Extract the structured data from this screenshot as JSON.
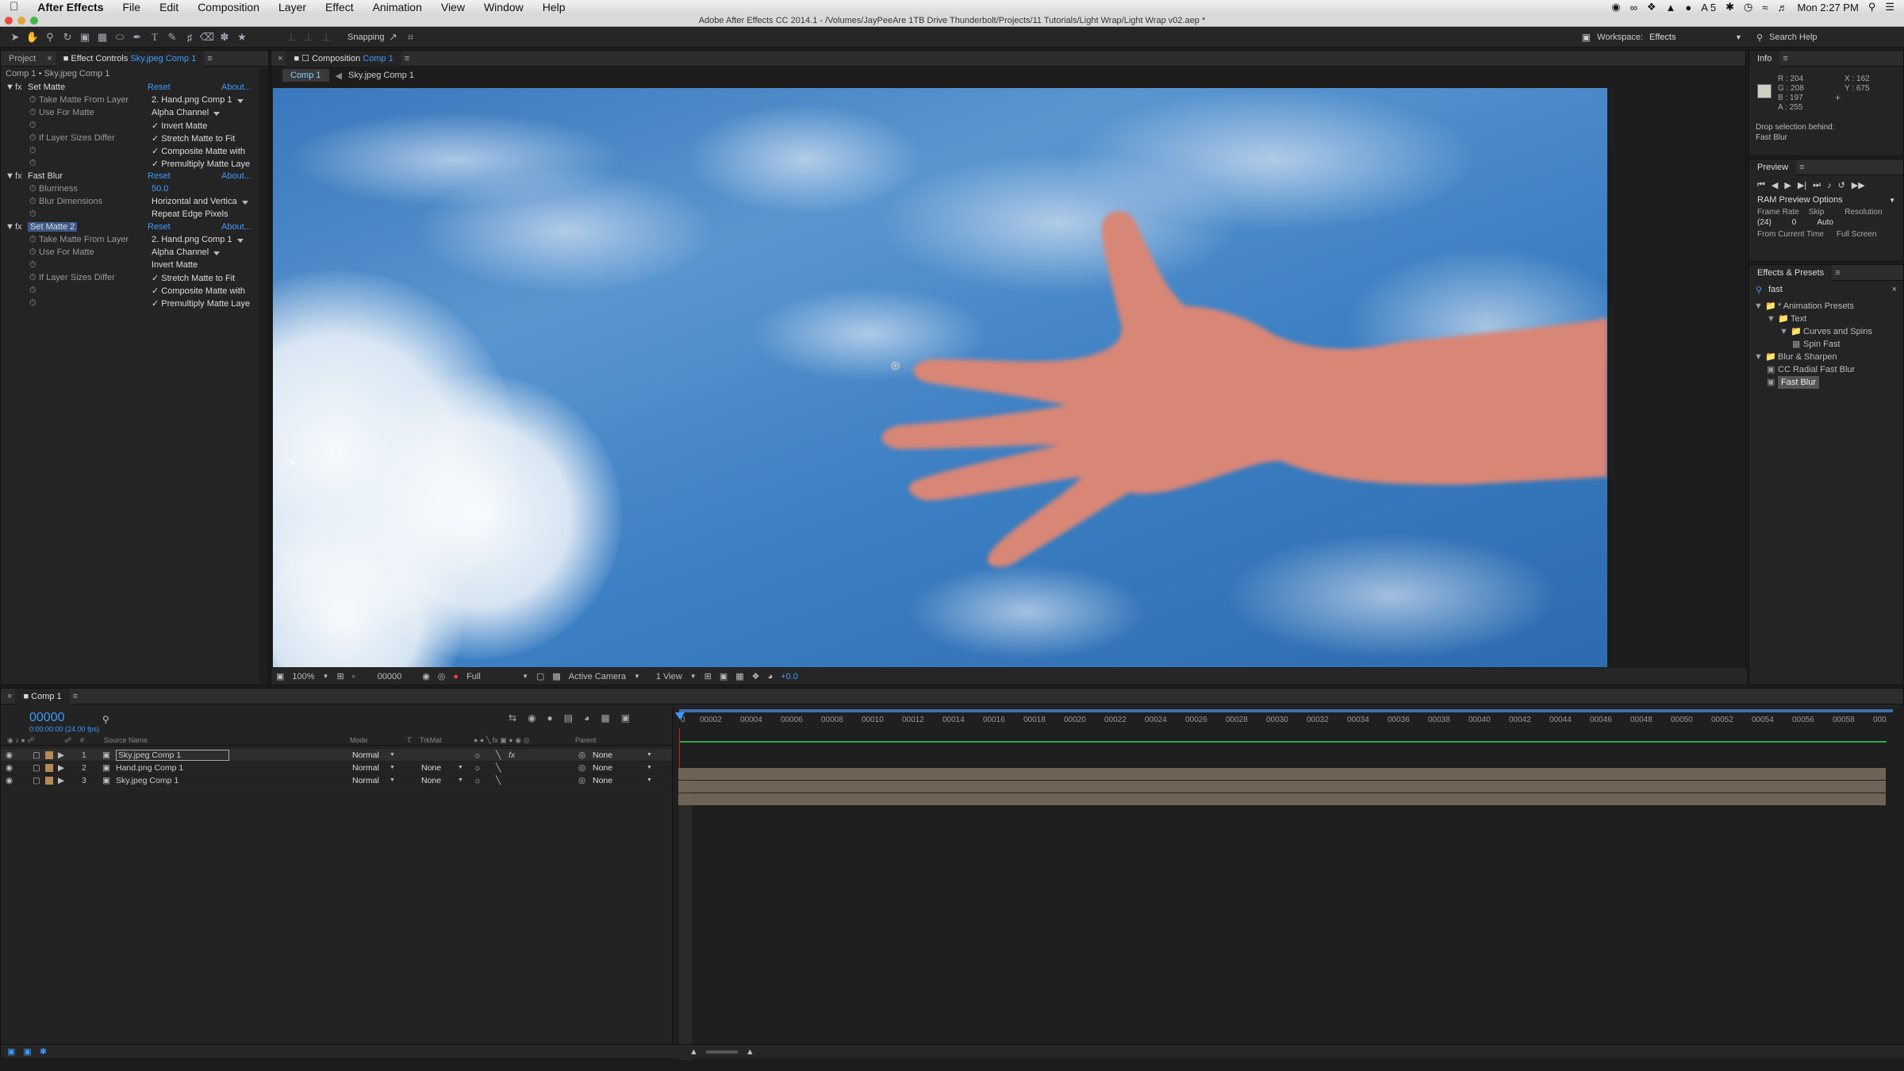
{
  "menubar": {
    "apple": "",
    "app_name": "After Effects",
    "items": [
      "File",
      "Edit",
      "Composition",
      "Layer",
      "Effect",
      "Animation",
      "View",
      "Window",
      "Help"
    ],
    "status": {
      "adobe_count": "5",
      "clock": "Mon 2:27 PM"
    }
  },
  "window": {
    "title": "Adobe After Effects CC 2014.1 - /Volumes/JayPeeAre 1TB Drive Thunderbolt/Projects/11 Tutorials/Light Wrap/Light Wrap v02.aep *"
  },
  "toolbar": {
    "snapping_label": "Snapping",
    "workspace_label": "Workspace:",
    "workspace_value": "Effects",
    "search_placeholder": "Search Help"
  },
  "left_panel": {
    "tabs": {
      "project": "Project",
      "effect_controls": "Effect Controls",
      "effect_controls_target": "Sky.jpeg Comp 1"
    },
    "breadcrumb": "Comp 1 • Sky.jpeg Comp 1",
    "effects": [
      {
        "name": "Set Matte",
        "reset": "Reset",
        "about": "About...",
        "props": [
          {
            "label": "Take Matte From Layer",
            "value": "2. Hand.png Comp 1",
            "dropdown": true
          },
          {
            "label": "Use For Matte",
            "value": "Alpha Channel",
            "dropdown": true
          },
          {
            "label": "",
            "value": "✓ Invert Matte"
          },
          {
            "label": "If Layer Sizes Differ",
            "value": "✓ Stretch Matte to Fit"
          },
          {
            "label": "",
            "value": "✓ Composite Matte with"
          },
          {
            "label": "",
            "value": "✓ Premultiply Matte Laye"
          }
        ]
      },
      {
        "name": "Fast Blur",
        "reset": "Reset",
        "about": "About...",
        "props": [
          {
            "label": "Blurriness",
            "value": "50.0",
            "blue": true
          },
          {
            "label": "Blur Dimensions",
            "value": "Horizontal and Verticа",
            "dropdown": true
          },
          {
            "label": "",
            "value": "Repeat Edge Pixels"
          }
        ]
      },
      {
        "name": "Set Matte 2",
        "reset": "Reset",
        "about": "About...",
        "props": [
          {
            "label": "Take Matte From Layer",
            "value": "2. Hand.png Comp 1",
            "dropdown": true
          },
          {
            "label": "Use For Matte",
            "value": "Alpha Channel",
            "dropdown": true
          },
          {
            "label": "",
            "value": "Invert Matte"
          },
          {
            "label": "If Layer Sizes Differ",
            "value": "✓ Stretch Matte to Fit"
          },
          {
            "label": "",
            "value": "✓ Composite Matte with"
          },
          {
            "label": "",
            "value": "✓ Premultiply Matte Laye"
          }
        ]
      }
    ]
  },
  "composition": {
    "panel_label": "Composition",
    "panel_target": "Comp 1",
    "nav": [
      "Comp 1",
      "Sky.jpeg Comp 1"
    ],
    "footer": {
      "zoom": "100%",
      "timecode": "00000",
      "resolution": "Full",
      "camera": "Active Camera",
      "views": "1 View",
      "exposure": "+0.0"
    }
  },
  "info_panel": {
    "title": "Info",
    "r": "R : 204",
    "g": "G : 208",
    "b": "B : 197",
    "a": "A : 255",
    "x": "X : 162",
    "y": "Y : 675",
    "drop_label": "Drop selection behind:",
    "drop_value": "Fast Blur",
    "swatch_color": "#ccd0c5"
  },
  "preview_panel": {
    "title": "Preview",
    "ram_options": "RAM Preview Options",
    "frame_rate_label": "Frame Rate",
    "skip_label": "Skip",
    "resolution_label": "Resolution",
    "frame_rate_value": "(24)",
    "skip_value": "0",
    "resolution_value": "Auto",
    "from_current": "From Current Time",
    "full_screen": "Full Screen"
  },
  "effects_presets": {
    "title": "Effects & Presets",
    "search_value": "fast",
    "tree": [
      {
        "level": 0,
        "label": "* Animation Presets",
        "type": "folder"
      },
      {
        "level": 1,
        "label": "Text",
        "type": "folder"
      },
      {
        "level": 2,
        "label": "Curves and Spins",
        "type": "folder"
      },
      {
        "level": 3,
        "label": "Spin Fast",
        "type": "preset"
      },
      {
        "level": 0,
        "label": "Blur & Sharpen",
        "type": "folder"
      },
      {
        "level": 1,
        "label": "CC Radial Fast Blur",
        "type": "effect"
      },
      {
        "level": 1,
        "label": "Fast Blur",
        "type": "effect",
        "selected": true
      }
    ]
  },
  "timeline": {
    "tab_label": "Comp 1",
    "timecode": "00000",
    "timecode_sub": "0:00:00:00 (24.00 fps)",
    "columns": {
      "source_name": "Source Name",
      "mode": "Mode",
      "t": "T",
      "trkmat": "TrkMat",
      "parent": "Parent",
      "hash": "#"
    },
    "layers": [
      {
        "num": "1",
        "name": "Sky.jpeg Comp 1",
        "mode": "Normal",
        "trkmat": "",
        "parent": "None",
        "selected": true
      },
      {
        "num": "2",
        "name": "Hand.png Comp 1",
        "mode": "Normal",
        "trkmat": "None",
        "parent": "None"
      },
      {
        "num": "3",
        "name": "Sky.jpeg Comp 1",
        "mode": "Normal",
        "trkmat": "None",
        "parent": "None"
      }
    ],
    "ruler": [
      "00002",
      "00004",
      "00006",
      "00008",
      "00010",
      "00012",
      "00014",
      "00016",
      "00018",
      "00020",
      "00022",
      "00024",
      "00026",
      "00028",
      "00030",
      "00032",
      "00034",
      "00036",
      "00038",
      "00040",
      "00042",
      "00044",
      "00046",
      "00048",
      "00050",
      "00052",
      "00054",
      "00056",
      "00058",
      "000"
    ],
    "ruler_start": "0"
  },
  "colors": {
    "accent": "#3d9bff",
    "playhead": "#d0201e",
    "work_area": "#2fa84a",
    "layer_bar": "#6e6456"
  }
}
